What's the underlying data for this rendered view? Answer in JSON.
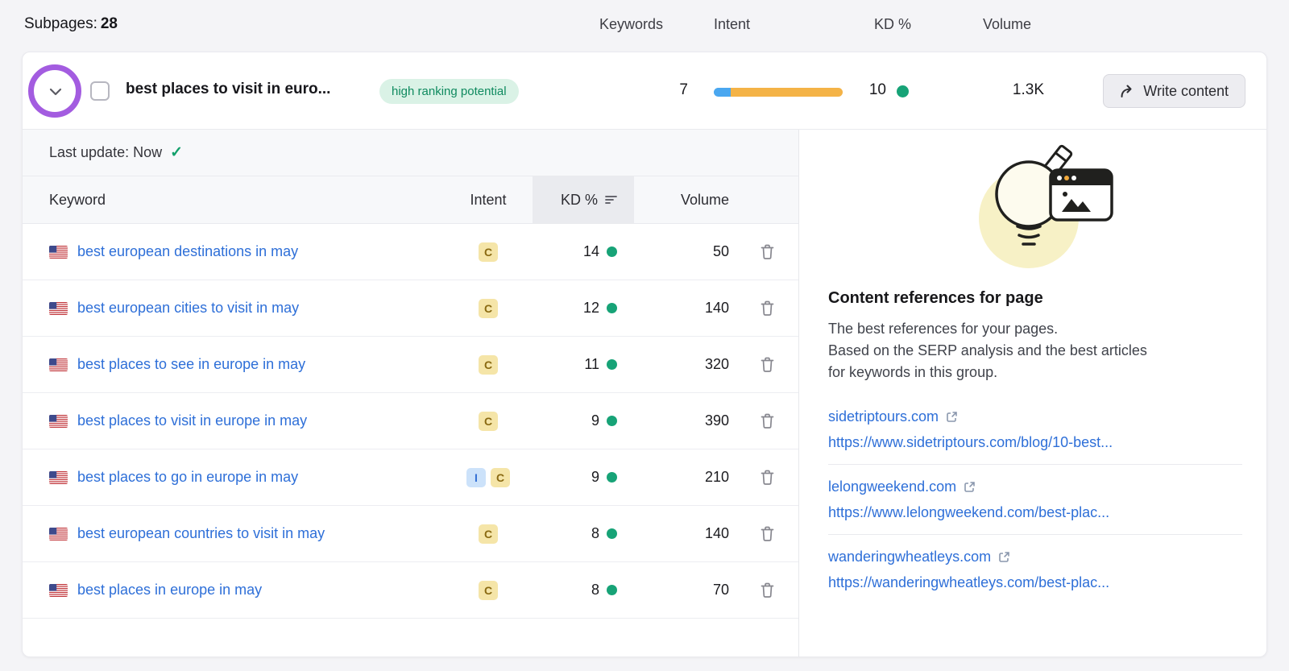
{
  "topbar": {
    "subpages_label": "Subpages:",
    "subpages_count": "28",
    "columns": [
      "Keywords",
      "Intent",
      "KD %",
      "Volume"
    ]
  },
  "parent": {
    "title": "best places to visit in euro...",
    "badge": "high ranking potential",
    "keywords_count": "7",
    "kd_value": "10",
    "volume": "1.3K",
    "write_button": "Write content",
    "intent_bar": {
      "segments": [
        {
          "color": "#4aa7f0",
          "pct": 13
        },
        {
          "color": "#f4b347",
          "pct": 87
        }
      ]
    }
  },
  "table": {
    "last_update_label": "Last update: Now",
    "headers": {
      "keyword": "Keyword",
      "intent": "Intent",
      "kd": "KD %",
      "volume": "Volume"
    },
    "rows": [
      {
        "keyword": "best european destinations in may",
        "intents": [
          "C"
        ],
        "kd": "14",
        "volume": "50"
      },
      {
        "keyword": "best european cities to visit in may",
        "intents": [
          "C"
        ],
        "kd": "12",
        "volume": "140"
      },
      {
        "keyword": "best places to see in europe in may",
        "intents": [
          "C"
        ],
        "kd": "11",
        "volume": "320"
      },
      {
        "keyword": "best places to visit in europe in may",
        "intents": [
          "C"
        ],
        "kd": "9",
        "volume": "390"
      },
      {
        "keyword": "best places to go in europe in may",
        "intents": [
          "I",
          "C"
        ],
        "kd": "9",
        "volume": "210"
      },
      {
        "keyword": "best european countries to visit in may",
        "intents": [
          "C"
        ],
        "kd": "8",
        "volume": "140"
      },
      {
        "keyword": "best places in europe in may",
        "intents": [
          "C"
        ],
        "kd": "8",
        "volume": "70"
      }
    ]
  },
  "sidebar": {
    "title": "Content references for page",
    "description_lines": [
      "The best references for your pages.",
      "Based on the SERP analysis and the best articles for keywords in this group."
    ],
    "references": [
      {
        "domain": "sidetriptours.com",
        "url": "https://www.sidetriptours.com/blog/10-best..."
      },
      {
        "domain": "lelongweekend.com",
        "url": "https://www.lelongweekend.com/best-plac..."
      },
      {
        "domain": "wanderingwheatleys.com",
        "url": "https://wanderingwheatleys.com/best-plac..."
      }
    ]
  },
  "icons": {
    "last_update_check": "✓"
  },
  "colors": {
    "link": "#2e6fd8",
    "kd_dot": "#17a377",
    "annotation_ring": "#a35ce0",
    "high_ranking_badge": {
      "bg": "#daf2e6",
      "fg": "#0f8a5f"
    },
    "intent": {
      "C": {
        "bg": "#f5e5a8",
        "fg": "#8a6a12"
      },
      "I": {
        "bg": "#cce2fa",
        "fg": "#3470d4"
      }
    }
  }
}
